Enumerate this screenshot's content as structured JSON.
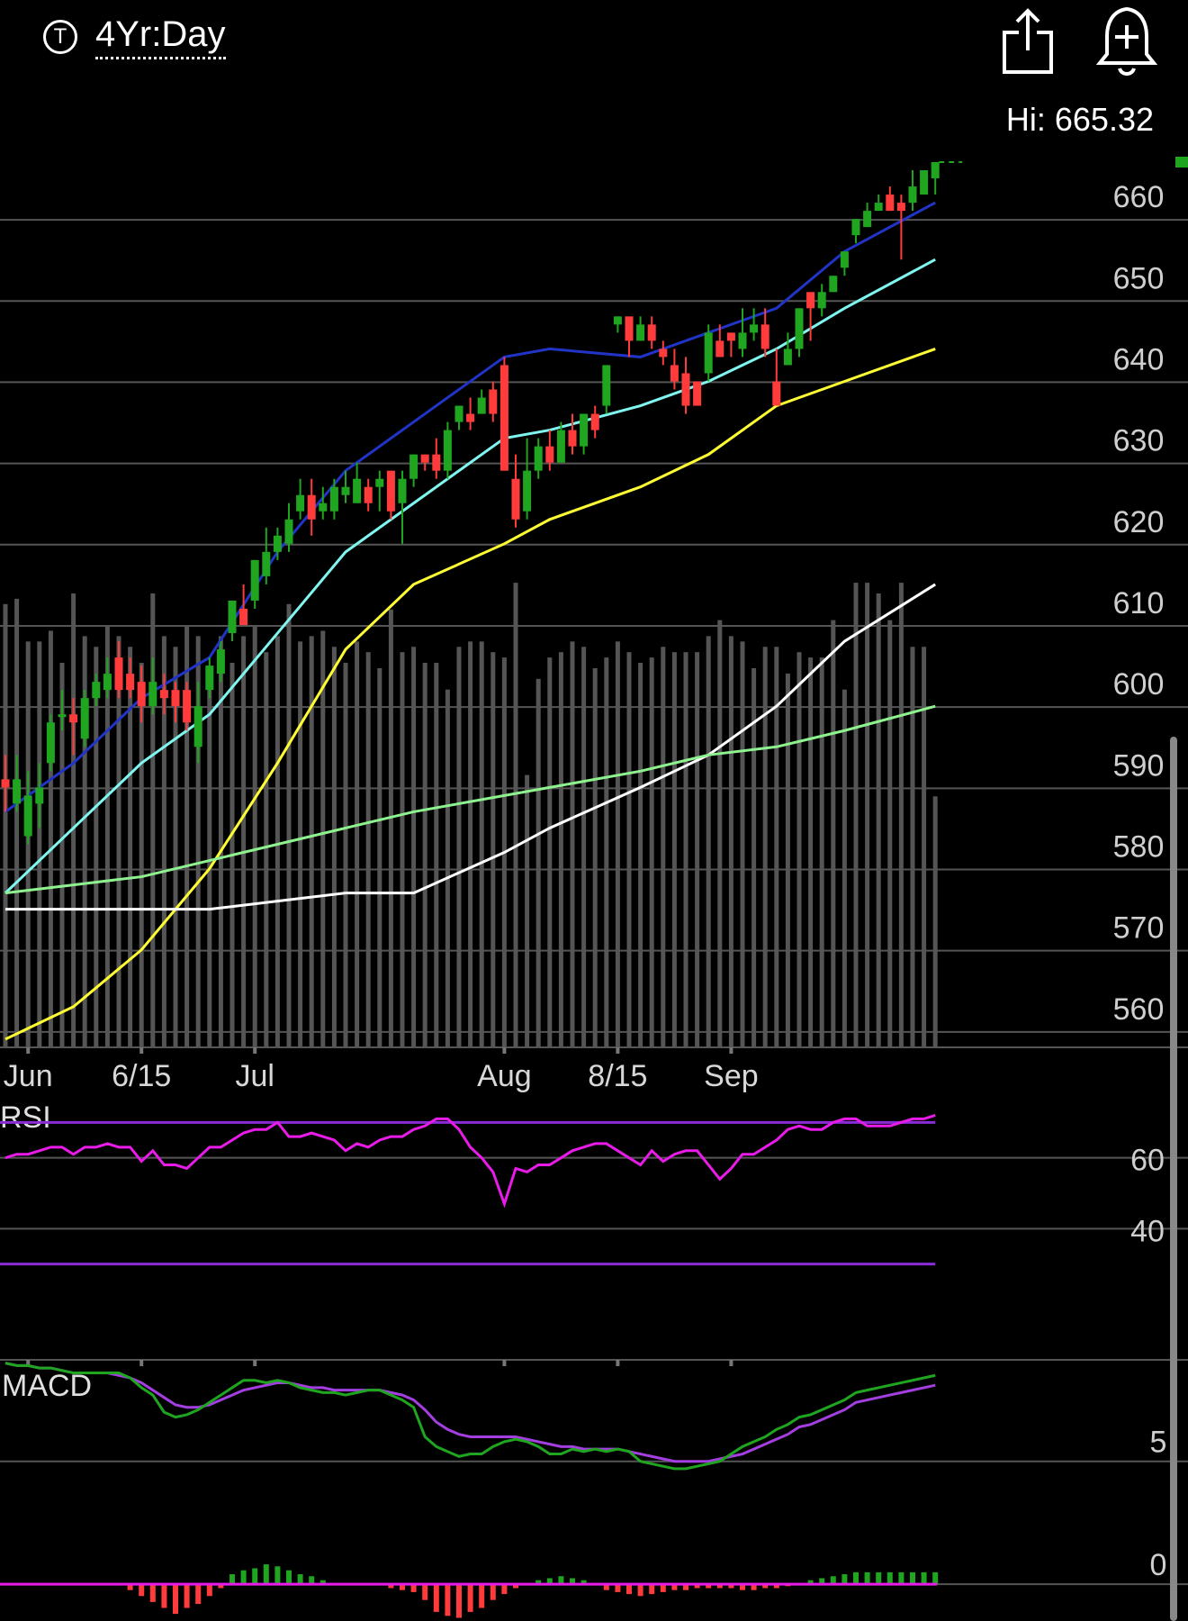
{
  "header": {
    "ticker_icon": "T",
    "period_label": "4Yr:Day",
    "share_icon": "share-icon",
    "alert_icon": "bell-plus-icon",
    "hi_label": "Hi: 665.32"
  },
  "colors": {
    "up": "#1fa51f",
    "down": "#ff3b3b",
    "sma_dark_blue": "#2134c8",
    "sma_cyan": "#7ff7f0",
    "sma_yellow": "#ffff33",
    "sma_white": "#ffffff",
    "sma_green": "#8ef28e",
    "volume": "#555555",
    "rsi": "#e81be8",
    "rsi_band": "#8a2bd8",
    "macd": "#1fa51f",
    "signal": "#a33ee0"
  },
  "chart_data": [
    {
      "type": "candlestick",
      "y_ticks": [
        660,
        650,
        640,
        630,
        620,
        610,
        600,
        590,
        580,
        570,
        560
      ],
      "ylim": [
        552,
        664
      ],
      "x_ticks": [
        {
          "label": "Jun",
          "index": 2
        },
        {
          "label": "6/15",
          "index": 12
        },
        {
          "label": "Jul",
          "index": 22
        },
        {
          "label": "Aug",
          "index": 44
        },
        {
          "label": "8/15",
          "index": 54
        },
        {
          "label": "Sep",
          "index": 64
        }
      ],
      "candles": [
        [
          588,
          587,
          584,
          591
        ],
        [
          585,
          588,
          584,
          591
        ],
        [
          581,
          586,
          580,
          589
        ],
        [
          585,
          587,
          582,
          590
        ],
        [
          590,
          595,
          589,
          596
        ],
        [
          596,
          596,
          594,
          599
        ],
        [
          596,
          595,
          591,
          598
        ],
        [
          593,
          598,
          592,
          599
        ],
        [
          598,
          600,
          597,
          601
        ],
        [
          599,
          601,
          598,
          603
        ],
        [
          603,
          599,
          598,
          605
        ],
        [
          601,
          599,
          598,
          603
        ],
        [
          600,
          597,
          595,
          602
        ],
        [
          597,
          600,
          596,
          603
        ],
        [
          599,
          598,
          596,
          601
        ],
        [
          599,
          597,
          595,
          600
        ],
        [
          599,
          595,
          594,
          600
        ],
        [
          592,
          597,
          590,
          600
        ],
        [
          599,
          602,
          598,
          603
        ],
        [
          601,
          604,
          600,
          605
        ],
        [
          606,
          610,
          605,
          610
        ],
        [
          609,
          607,
          607,
          612
        ],
        [
          610,
          615,
          609,
          615
        ],
        [
          613,
          616,
          612,
          619
        ],
        [
          616,
          618,
          615,
          619
        ],
        [
          617,
          620,
          616,
          622
        ],
        [
          621,
          623,
          620,
          625
        ],
        [
          623,
          620,
          618,
          625
        ],
        [
          621,
          622,
          620,
          624
        ],
        [
          621,
          624,
          620,
          625
        ],
        [
          623,
          624,
          622,
          626
        ],
        [
          622,
          625,
          622,
          627
        ],
        [
          624,
          622,
          621,
          625
        ],
        [
          624,
          625,
          621,
          626
        ],
        [
          626,
          621,
          620,
          626
        ],
        [
          622,
          625,
          617,
          626
        ],
        [
          625,
          628,
          624,
          628
        ],
        [
          628,
          627,
          626,
          628
        ],
        [
          628,
          626,
          625,
          630
        ],
        [
          626,
          631,
          625,
          632
        ],
        [
          632,
          634,
          631,
          634
        ],
        [
          633,
          632,
          631,
          635
        ],
        [
          633,
          635,
          633,
          636
        ],
        [
          636,
          633,
          632,
          637
        ],
        [
          639,
          626,
          626,
          640
        ],
        [
          625,
          620,
          619,
          628
        ],
        [
          621,
          626,
          620,
          630
        ],
        [
          626,
          629,
          625,
          630
        ],
        [
          629,
          627,
          626,
          631
        ],
        [
          627,
          631,
          627,
          632
        ],
        [
          631,
          629,
          628,
          633
        ],
        [
          629,
          633,
          628,
          633
        ],
        [
          633,
          631,
          630,
          634
        ],
        [
          634,
          639,
          633,
          639
        ],
        [
          644,
          645,
          643,
          645
        ],
        [
          645,
          642,
          640,
          644
        ],
        [
          642,
          644,
          642,
          645
        ],
        [
          644,
          642,
          641,
          645
        ],
        [
          641,
          640,
          639,
          642
        ],
        [
          639,
          637,
          636,
          641
        ],
        [
          638,
          634,
          633,
          640
        ],
        [
          637,
          634,
          634,
          635
        ],
        [
          638,
          643,
          637,
          644
        ],
        [
          642,
          640,
          640,
          644
        ],
        [
          643,
          642,
          640,
          643
        ],
        [
          641,
          643,
          640,
          646
        ],
        [
          643,
          644,
          642,
          646
        ],
        [
          644,
          641,
          640,
          646
        ],
        [
          637,
          634,
          634,
          641
        ],
        [
          639,
          641,
          639,
          643
        ],
        [
          641,
          646,
          640,
          646
        ],
        [
          648,
          646,
          642,
          647
        ],
        [
          646,
          648,
          645,
          649
        ],
        [
          648,
          650,
          648,
          650
        ],
        [
          651,
          653,
          650,
          653
        ],
        [
          655,
          657,
          654,
          656
        ],
        [
          656,
          658,
          656,
          659
        ],
        [
          658,
          659,
          659,
          660
        ],
        [
          660,
          658,
          658,
          661
        ],
        [
          659,
          658,
          652,
          660
        ],
        [
          659,
          661,
          658,
          663
        ],
        [
          660,
          663,
          662,
          663
        ],
        [
          662,
          664,
          660,
          664
        ]
      ],
      "volume_heights": [
        0.83,
        0.84,
        0.76,
        0.76,
        0.78,
        0.72,
        0.85,
        0.77,
        0.75,
        0.79,
        0.77,
        0.75,
        0.72,
        0.85,
        0.77,
        0.75,
        0.79,
        0.77,
        0.7,
        0.77,
        0.72,
        0.77,
        0.79,
        0.74,
        0.77,
        0.83,
        0.76,
        0.77,
        0.78,
        0.75,
        0.72,
        0.76,
        0.74,
        0.71,
        0.82,
        0.74,
        0.75,
        0.72,
        0.72,
        0.67,
        0.75,
        0.76,
        0.76,
        0.74,
        0.73,
        0.87,
        0.51,
        0.69,
        0.73,
        0.74,
        0.76,
        0.75,
        0.71,
        0.73,
        0.76,
        0.74,
        0.72,
        0.73,
        0.75,
        0.74,
        0.74,
        0.74,
        0.77,
        0.8,
        0.77,
        0.76,
        0.71,
        0.75,
        0.75,
        0.7,
        0.74,
        0.73,
        0.73,
        0.8,
        0.67,
        0.87,
        0.87,
        0.85,
        0.8,
        0.87,
        0.75,
        0.75,
        0.47
      ],
      "sma_lines": {
        "sma_dark_blue": [
          [
            0,
            584
          ],
          [
            6,
            590
          ],
          [
            12,
            598
          ],
          [
            18,
            603
          ],
          [
            24,
            616
          ],
          [
            30,
            626
          ],
          [
            36,
            632
          ],
          [
            44,
            640
          ],
          [
            48,
            641
          ],
          [
            56,
            640
          ],
          [
            62,
            643
          ],
          [
            68,
            646
          ],
          [
            74,
            653
          ],
          [
            82,
            659
          ]
        ],
        "sma_cyan": [
          [
            0,
            574
          ],
          [
            6,
            582
          ],
          [
            12,
            590
          ],
          [
            18,
            596
          ],
          [
            24,
            606
          ],
          [
            30,
            616
          ],
          [
            36,
            622
          ],
          [
            44,
            630
          ],
          [
            48,
            631
          ],
          [
            56,
            634
          ],
          [
            62,
            637
          ],
          [
            68,
            641
          ],
          [
            74,
            646
          ],
          [
            82,
            652
          ]
        ],
        "sma_yellow": [
          [
            0,
            556
          ],
          [
            6,
            560
          ],
          [
            12,
            567
          ],
          [
            18,
            577
          ],
          [
            24,
            590
          ],
          [
            30,
            604
          ],
          [
            36,
            612
          ],
          [
            44,
            617
          ],
          [
            48,
            620
          ],
          [
            56,
            624
          ],
          [
            62,
            628
          ],
          [
            68,
            634
          ],
          [
            74,
            637
          ],
          [
            82,
            641
          ]
        ],
        "sma_white": [
          [
            0,
            572
          ],
          [
            6,
            572
          ],
          [
            12,
            572
          ],
          [
            18,
            572
          ],
          [
            24,
            573
          ],
          [
            30,
            574
          ],
          [
            36,
            574
          ],
          [
            44,
            579
          ],
          [
            48,
            582
          ],
          [
            56,
            587
          ],
          [
            62,
            591
          ],
          [
            68,
            597
          ],
          [
            74,
            605
          ],
          [
            82,
            612
          ]
        ],
        "sma_green": [
          [
            0,
            574
          ],
          [
            6,
            575
          ],
          [
            12,
            576
          ],
          [
            18,
            578
          ],
          [
            24,
            580
          ],
          [
            30,
            582
          ],
          [
            36,
            584
          ],
          [
            44,
            586
          ],
          [
            48,
            587
          ],
          [
            56,
            589
          ],
          [
            62,
            591
          ],
          [
            68,
            592
          ],
          [
            74,
            594
          ],
          [
            82,
            597
          ]
        ]
      }
    },
    {
      "type": "line",
      "title": "RSI",
      "y_ticks": [
        60,
        40
      ],
      "ylim": [
        20,
        80
      ],
      "bands": [
        70,
        30
      ],
      "values": [
        60,
        61,
        61,
        62,
        63,
        63,
        61,
        63,
        63,
        64,
        63,
        63,
        59,
        62,
        58,
        58,
        57,
        60,
        63,
        63,
        65,
        67,
        68,
        68,
        70,
        66,
        66,
        67,
        66,
        65,
        62,
        64,
        63,
        65,
        66,
        66,
        68,
        69,
        71,
        71,
        68,
        63,
        60,
        56,
        47,
        57,
        56,
        58,
        58,
        60,
        62,
        63,
        64,
        64,
        62,
        60,
        58,
        62,
        59,
        61,
        62,
        62,
        58,
        54,
        57,
        61,
        61,
        63,
        65,
        68,
        69,
        68,
        68,
        70,
        71,
        71,
        69,
        69,
        69,
        70,
        71,
        71,
        72
      ]
    },
    {
      "type": "line",
      "title": "MACD",
      "y_ticks": [
        5,
        0
      ],
      "ylim": [
        -1.5,
        9.5
      ],
      "macd": [
        9.0,
        8.9,
        8.9,
        8.8,
        8.8,
        8.7,
        8.6,
        8.6,
        8.6,
        8.6,
        8.6,
        8.4,
        8.0,
        7.7,
        7.0,
        6.8,
        6.9,
        7.1,
        7.4,
        7.7,
        8.0,
        8.3,
        8.3,
        8.2,
        8.3,
        8.2,
        8.0,
        7.9,
        7.8,
        7.8,
        7.7,
        7.8,
        7.9,
        7.9,
        7.7,
        7.5,
        7.2,
        6.0,
        5.6,
        5.4,
        5.2,
        5.3,
        5.3,
        5.6,
        5.8,
        5.9,
        5.8,
        5.6,
        5.3,
        5.3,
        5.5,
        5.4,
        5.5,
        5.4,
        5.5,
        5.4,
        5.0,
        4.9,
        4.8,
        4.7,
        4.7,
        4.8,
        4.9,
        5.0,
        5.3,
        5.6,
        5.8,
        6.0,
        6.3,
        6.5,
        6.8,
        6.9,
        7.1,
        7.3,
        7.5,
        7.8,
        7.9,
        8.0,
        8.1,
        8.2,
        8.3,
        8.4,
        8.5
      ],
      "signal": [
        9.0,
        8.9,
        8.9,
        8.8,
        8.8,
        8.7,
        8.6,
        8.6,
        8.6,
        8.6,
        8.5,
        8.4,
        8.2,
        7.9,
        7.6,
        7.3,
        7.2,
        7.2,
        7.3,
        7.5,
        7.7,
        7.9,
        8.0,
        8.1,
        8.2,
        8.2,
        8.1,
        8.0,
        8.0,
        7.9,
        7.9,
        7.9,
        7.9,
        7.9,
        7.8,
        7.7,
        7.5,
        7.1,
        6.6,
        6.3,
        6.1,
        6.0,
        6.0,
        6.0,
        6.0,
        6.0,
        5.9,
        5.8,
        5.7,
        5.6,
        5.6,
        5.5,
        5.5,
        5.5,
        5.5,
        5.4,
        5.3,
        5.2,
        5.1,
        5.0,
        5.0,
        5.0,
        5.0,
        5.1,
        5.2,
        5.3,
        5.5,
        5.7,
        5.9,
        6.1,
        6.4,
        6.5,
        6.7,
        6.9,
        7.1,
        7.4,
        7.5,
        7.6,
        7.7,
        7.8,
        7.9,
        8.0,
        8.1
      ],
      "histogram_levels": [
        0,
        0,
        0,
        0,
        0,
        0,
        0,
        0,
        0,
        0,
        0,
        -0.3,
        -0.6,
        -0.9,
        -1.2,
        -1.5,
        -1.2,
        -1.0,
        -0.6,
        -0.2,
        0.5,
        0.7,
        0.8,
        1.0,
        0.9,
        0.7,
        0.5,
        0.4,
        0.2,
        0,
        0,
        0,
        0,
        0,
        -0.2,
        -0.3,
        -0.4,
        -0.8,
        -1.4,
        -1.6,
        -1.7,
        -1.4,
        -1.2,
        -0.8,
        -0.5,
        -0.2,
        0,
        0.2,
        0.3,
        0.4,
        0.3,
        0.2,
        0,
        -0.3,
        -0.4,
        -0.5,
        -0.6,
        -0.5,
        -0.4,
        -0.3,
        -0.3,
        -0.2,
        -0.2,
        -0.2,
        -0.2,
        -0.3,
        -0.3,
        -0.2,
        -0.2,
        -0.1,
        0,
        0.2,
        0.3,
        0.4,
        0.5,
        0.6,
        0.6,
        0.6,
        0.6,
        0.6,
        0.6,
        0.6,
        0.6
      ]
    }
  ]
}
